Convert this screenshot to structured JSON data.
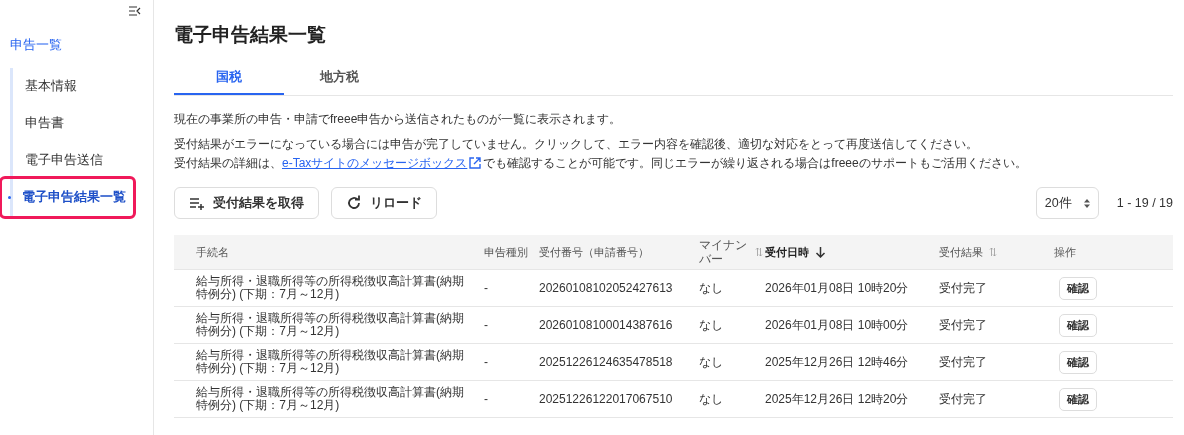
{
  "sidebar": {
    "heading": "申告一覧",
    "items": [
      {
        "label": "基本情報",
        "selected": false,
        "highlighted": false
      },
      {
        "label": "申告書",
        "selected": false,
        "highlighted": false
      },
      {
        "label": "電子申告送信",
        "selected": false,
        "highlighted": false
      },
      {
        "label": "電子申告結果一覧",
        "selected": true,
        "highlighted": true
      }
    ]
  },
  "page": {
    "title": "電子申告結果一覧",
    "tabs": [
      {
        "label": "国税",
        "selected": true
      },
      {
        "label": "地方税",
        "selected": false
      }
    ],
    "description": [
      "現在の事業所の申告・申請でfreee申告から送信されたものが一覧に表示されます。",
      "受付結果がエラーになっている場合には申告が完了していません。クリックして、エラー内容を確認後、適切な対応をとって再度送信してください。"
    ],
    "detail": {
      "before": "受付結果の詳細は、",
      "link": "e-Taxサイトのメッセージボックス",
      "after": "でも確認することが可能です。同じエラーが繰り返される場合はfreeeのサポートもご活用ください。"
    },
    "buttons": [
      {
        "label": "受付結果を取得",
        "kind": "fetch"
      },
      {
        "label": "リロード",
        "kind": "reload"
      }
    ],
    "per_page": "20件",
    "range": "1 - 19 / 19"
  },
  "table": {
    "columns": [
      {
        "label": "手続名",
        "sortable": false,
        "sorted_descending": false
      },
      {
        "label": "申告種別",
        "sortable": false,
        "sorted_descending": false
      },
      {
        "label": "受付番号（申請番号）",
        "sortable": false,
        "sorted_descending": false
      },
      {
        "label": "マイナンバー",
        "sortable": true,
        "sorted_descending": false
      },
      {
        "label": "受付日時",
        "sortable": true,
        "sorted_descending": true
      },
      {
        "label": "受付結果",
        "sortable": true,
        "sorted_descending": false
      },
      {
        "label": "操作",
        "sortable": false,
        "sorted_descending": false
      }
    ],
    "rows": [
      {
        "procedure": "給与所得・退職所得等の所得税徴収高計算書(納期特例分) (下期：7月～12月)",
        "type": "-",
        "number": "20260108102052427613",
        "mynumber": "なし",
        "datetime": "2026年01月08日 10時20分",
        "result": "受付完了",
        "action": "確認"
      },
      {
        "procedure": "給与所得・退職所得等の所得税徴収高計算書(納期特例分) (下期：7月～12月)",
        "type": "-",
        "number": "20260108100014387616",
        "mynumber": "なし",
        "datetime": "2026年01月08日 10時00分",
        "result": "受付完了",
        "action": "確認"
      },
      {
        "procedure": "給与所得・退職所得等の所得税徴収高計算書(納期特例分) (下期：7月～12月)",
        "type": "-",
        "number": "20251226124635478518",
        "mynumber": "なし",
        "datetime": "2025年12月26日 12時46分",
        "result": "受付完了",
        "action": "確認"
      },
      {
        "procedure": "給与所得・退職所得等の所得税徴収高計算書(納期特例分) (下期：7月～12月)",
        "type": "-",
        "number": "20251226122017067510",
        "mynumber": "なし",
        "datetime": "2025年12月26日 12時20分",
        "result": "受付完了",
        "action": "確認"
      }
    ]
  }
}
